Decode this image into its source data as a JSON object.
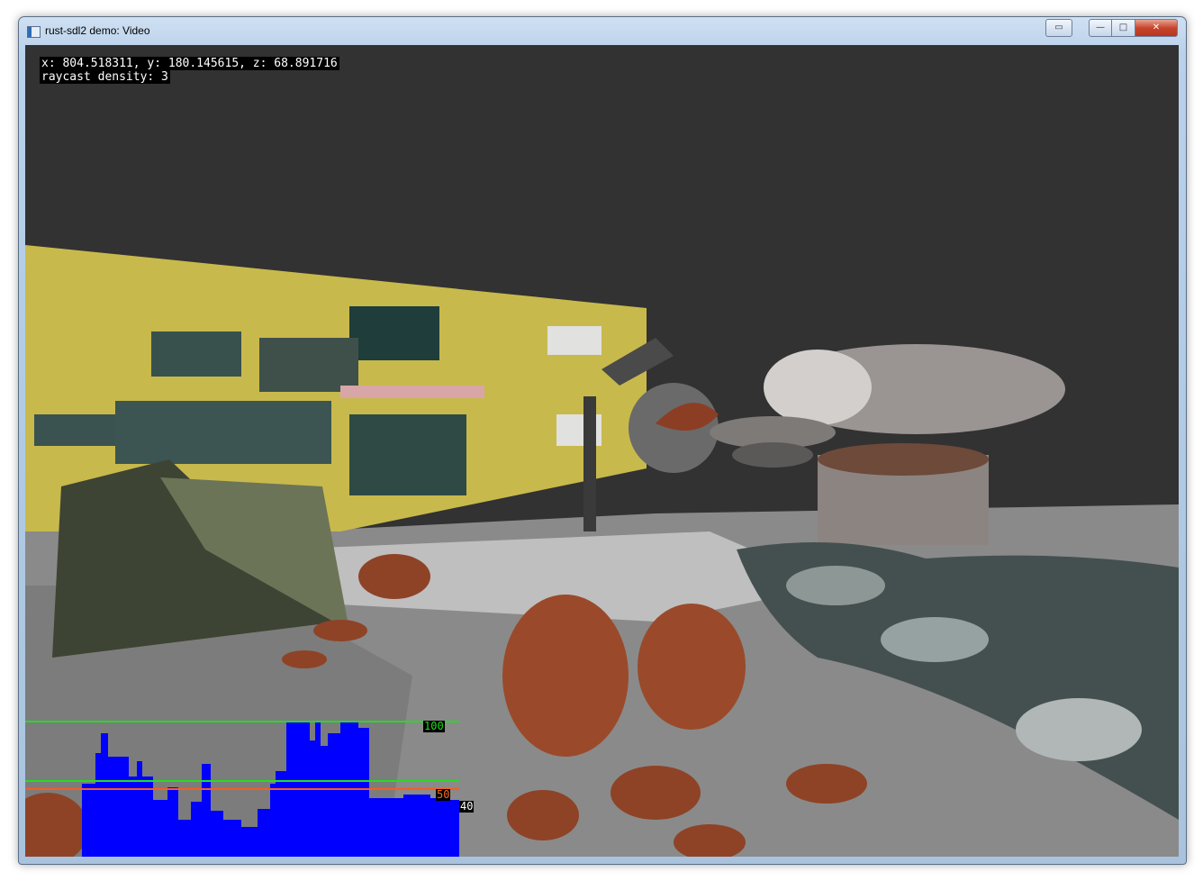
{
  "window": {
    "title": "rust-sdl2 demo: Video",
    "controls": {
      "minimize": "▭",
      "maximize": "□",
      "close": "✕"
    }
  },
  "hud": {
    "position_line": "x: 804.518311, y: 180.145615, z: 68.891716",
    "density_line": "raycast density: 3"
  },
  "graph": {
    "label_high": "100",
    "label_mid": "50",
    "label_current": "40",
    "colors": {
      "fill": "#0000ff",
      "high_line": "#22dd22",
      "mid_line": "#ff5a1a",
      "mid_green": "#22dd22"
    }
  },
  "colors": {
    "background": "#323232",
    "wall": "#c9bb4a",
    "floor": "#8e8e8e",
    "dirt": "#9a4a2a"
  }
}
